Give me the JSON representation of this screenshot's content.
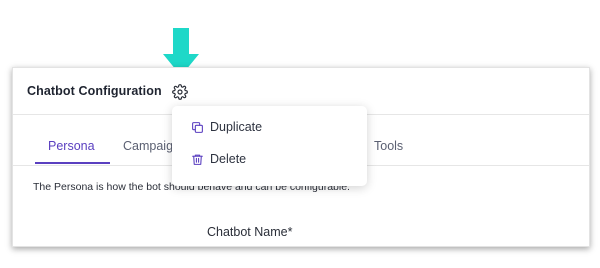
{
  "header": {
    "title": "Chatbot Configuration",
    "settings_icon": "gear-icon"
  },
  "tabs": [
    {
      "label": "Persona",
      "active": true
    },
    {
      "label": "Campaig"
    },
    {
      "label": "Tools"
    }
  ],
  "persona": {
    "description": "The Persona is how the bot should behave and can be configurable.",
    "field_label": "Chatbot Name*"
  },
  "menu": {
    "items": [
      {
        "label": "Duplicate",
        "icon": "copy-icon"
      },
      {
        "label": "Delete",
        "icon": "trash-icon"
      }
    ]
  },
  "colors": {
    "accent": "#5a3fc0",
    "pointer": "#1ed8c8"
  }
}
